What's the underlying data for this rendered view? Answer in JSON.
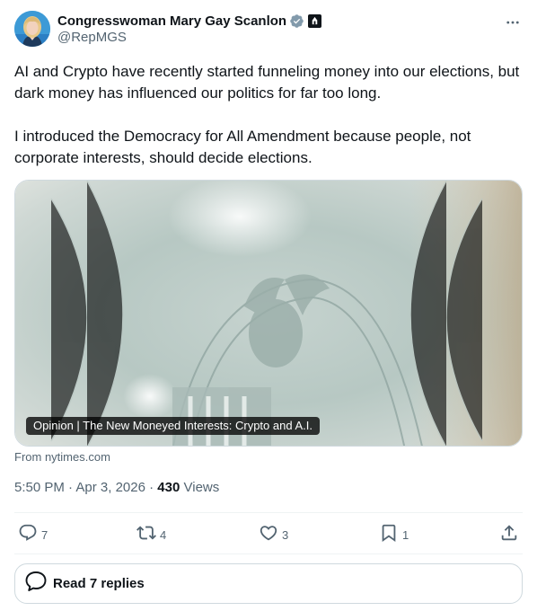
{
  "author": {
    "name": "Congresswoman Mary Gay Scanlon",
    "handle": "@RepMGS",
    "verified_color": "#829aab"
  },
  "tweet": {
    "paragraphs": [
      "AI and Crypto have recently started funneling money into our elections, but dark money has influenced our politics for far too long.",
      "I introduced the Democracy for All Amendment because people, not corporate interests, should decide elections."
    ]
  },
  "card": {
    "caption": "Opinion | The New Moneyed Interests: Crypto and A.I.",
    "source": "From nytimes.com"
  },
  "meta": {
    "time": "5:50 PM",
    "date": "Apr 3, 2026",
    "views_count": "430",
    "views_label": "Views",
    "separator": "·"
  },
  "actions": {
    "replies": "7",
    "reposts": "4",
    "likes": "3",
    "bookmarks": "1"
  },
  "read_replies": {
    "label": "Read 7 replies"
  },
  "icons": {
    "more": "more-horizontal-icon",
    "reply": "reply-icon",
    "repost": "repost-icon",
    "like": "heart-icon",
    "bookmark": "bookmark-icon",
    "share": "share-icon",
    "replies": "speech-bubble-icon"
  },
  "colors": {
    "text": "#0f1419",
    "secondary": "#536471",
    "border": "#cfd9de",
    "accent": "#1d9bf0"
  }
}
